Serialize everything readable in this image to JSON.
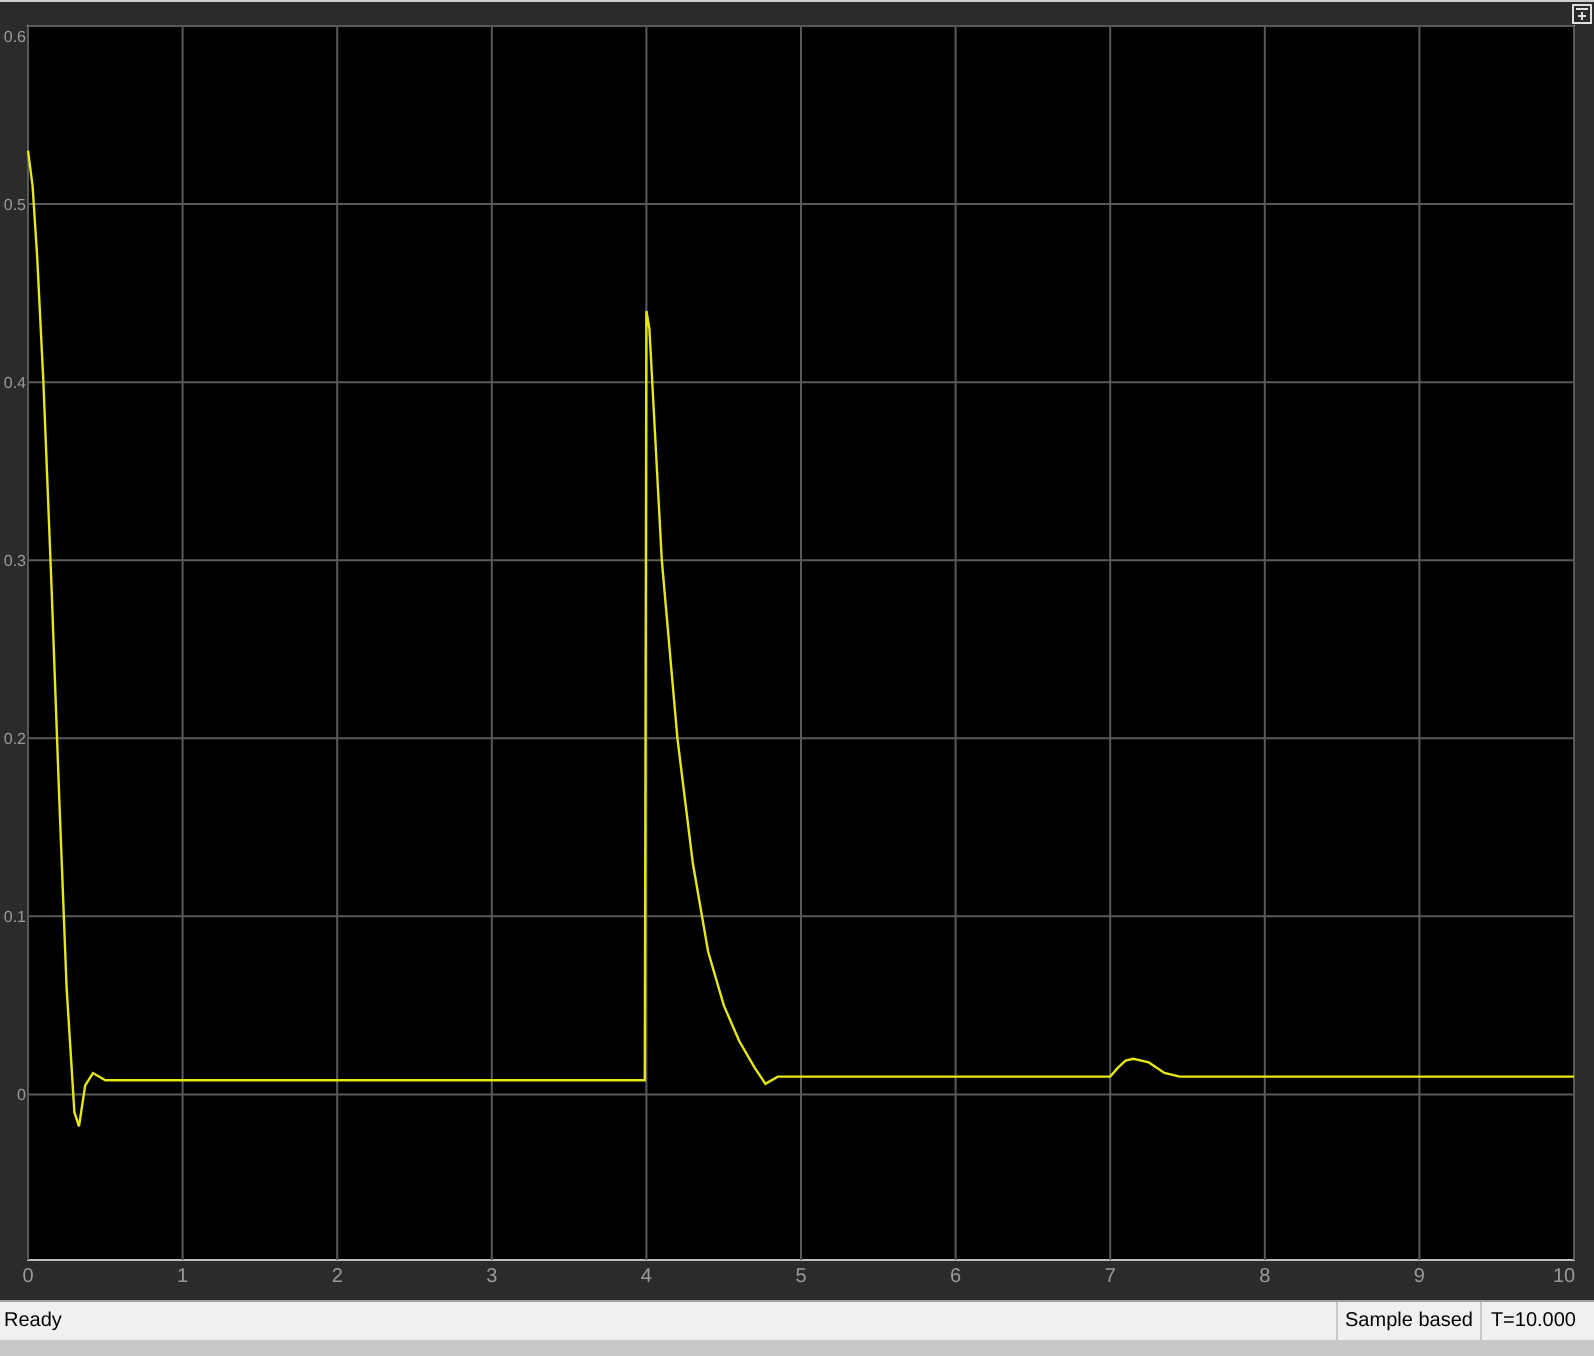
{
  "chart_data": {
    "type": "line",
    "grid": true,
    "xlim": [
      0,
      10
    ],
    "ylim": [
      -0.093,
      0.6
    ],
    "xticks": [
      0,
      1,
      2,
      3,
      4,
      5,
      6,
      7,
      8,
      9,
      10
    ],
    "yticks": [
      0,
      0.1,
      0.2,
      0.3,
      0.4,
      0.5,
      0.6
    ],
    "x": [
      0,
      0.03,
      0.06,
      0.1,
      0.15,
      0.2,
      0.25,
      0.3,
      0.33,
      0.37,
      0.42,
      0.5,
      1,
      2,
      3,
      3.99,
      4.0,
      4.02,
      4.1,
      4.2,
      4.3,
      4.4,
      4.5,
      4.6,
      4.7,
      4.77,
      4.85,
      5,
      6,
      7,
      7.05,
      7.1,
      7.15,
      7.25,
      7.35,
      7.45,
      7.55,
      8,
      9,
      10
    ],
    "series": [
      {
        "color": "#e6e619",
        "values": [
          0.53,
          0.51,
          0.47,
          0.4,
          0.29,
          0.17,
          0.06,
          -0.01,
          -0.018,
          0.005,
          0.012,
          0.008,
          0.008,
          0.008,
          0.008,
          0.008,
          0.44,
          0.43,
          0.3,
          0.2,
          0.13,
          0.08,
          0.05,
          0.03,
          0.015,
          0.006,
          0.01,
          0.01,
          0.01,
          0.01,
          0.015,
          0.019,
          0.02,
          0.018,
          0.012,
          0.01,
          0.01,
          0.01,
          0.01,
          0.01
        ]
      }
    ]
  },
  "status_bar": {
    "message": "Ready",
    "sample_mode": "Sample based",
    "time": "T=10.000"
  }
}
